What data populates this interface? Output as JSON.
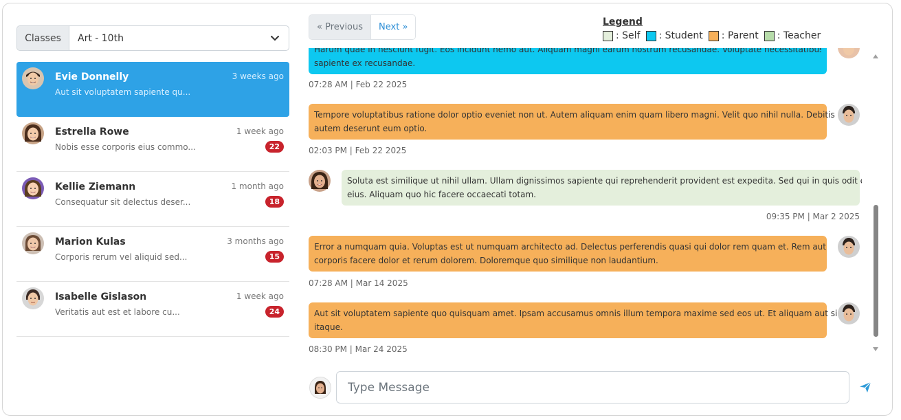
{
  "class_selector": {
    "prefix": "Classes",
    "selected": "Art - 10th"
  },
  "conversations": [
    {
      "name": "Evie Donnelly",
      "preview": "Aut sit voluptatem sapiente qu...",
      "time": "3 weeks ago",
      "badge": "",
      "active": true
    },
    {
      "name": "Estrella Rowe",
      "preview": "Nobis esse corporis eius commo...",
      "time": "1 week ago",
      "badge": "22"
    },
    {
      "name": "Kellie Ziemann",
      "preview": "Consequatur sit delectus deser...",
      "time": "1 month ago",
      "badge": "18"
    },
    {
      "name": "Marion Kulas",
      "preview": "Corporis rerum vel aliquid sed...",
      "time": "3 months ago",
      "badge": "15"
    },
    {
      "name": "Isabelle Gislason",
      "preview": "Veritatis aut est et labore cu...",
      "time": "1 week ago",
      "badge": "24"
    }
  ],
  "pager": {
    "previous": "« Previous",
    "next": "Next »"
  },
  "legend": {
    "title": "Legend",
    "items": [
      {
        "label": ": Self",
        "color": "#e4efdc"
      },
      {
        "label": ": Student",
        "color": "#0dc8f0"
      },
      {
        "label": ": Parent",
        "color": "#f6b05a"
      },
      {
        "label": ": Teacher",
        "color": "#b7dcaa"
      }
    ]
  },
  "messages": [
    {
      "text_line1": "Harum quae in nesciunt fugit. Eos incidunt nemo aut. Aliquam magni earum nostrum recusandae. Voluptate necessitatibus",
      "text_line2": "sapiente ex recusandae.",
      "time": "07:28 AM | Feb 22 2025",
      "role": "student"
    },
    {
      "text_line1": "Tempore voluptatibus ratione dolor optio eveniet non ut. Autem aliquam enim quam libero magni. Velit quo nihil nulla. Debitis",
      "text_line2": "autem deserunt eum optio.",
      "time": "02:03 PM | Feb 22 2025",
      "role": "parent"
    },
    {
      "text_line1": "Soluta est similique ut nihil ullam. Ullam dignissimos sapiente qui reprehenderit provident est expedita. Sed qui in quis odit enim",
      "text_line2": "eius. Aliquam quo hic facere occaecati totam.",
      "time": "09:35 PM | Mar 2 2025",
      "role": "self"
    },
    {
      "text_line1": "Error a numquam quia. Voluptas est ut numquam architecto ad. Delectus perferendis quasi qui dolor rem quam et. Rem aut",
      "text_line2": "corporis facere dolor et rerum dolorem. Doloremque quo similique non laudantium.",
      "time": "07:28 AM | Mar 14 2025",
      "role": "parent"
    },
    {
      "text_line1": "Aut sit voluptatem sapiente quo quisquam amet. Ipsam accusamus omnis illum tempora maxime sed eos ut. Et aliquam aut sint",
      "text_line2": "itaque.",
      "time": "08:30 PM | Mar 24 2025",
      "role": "parent"
    }
  ],
  "compose": {
    "placeholder": "Type Message"
  },
  "icons": {
    "dropdown": "chevron-down-icon",
    "send": "send-icon"
  }
}
